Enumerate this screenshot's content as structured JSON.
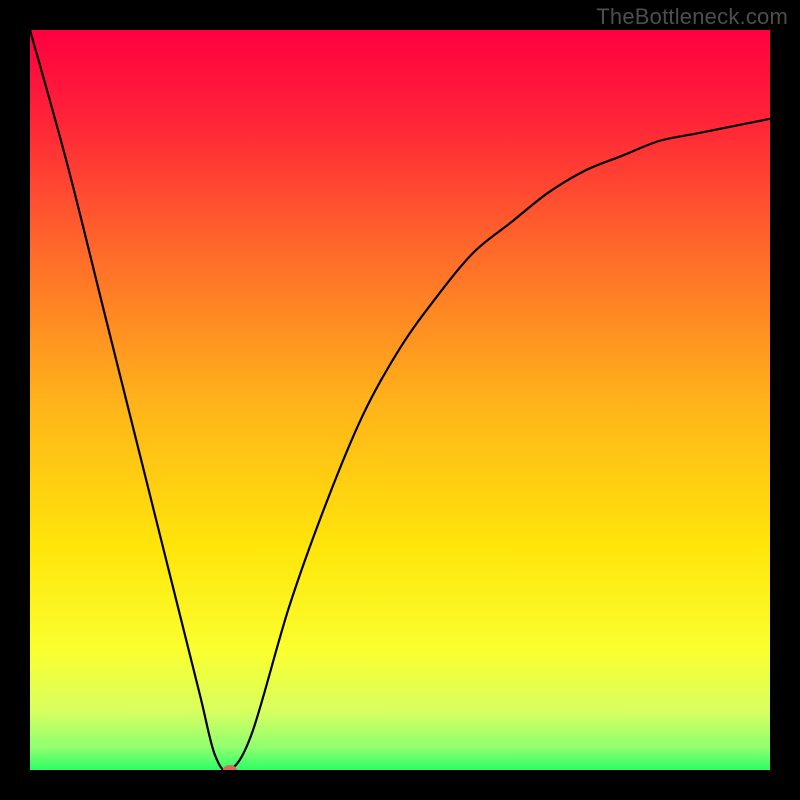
{
  "watermark": "TheBottleneck.com",
  "chart_data": {
    "type": "line",
    "title": "",
    "xlabel": "",
    "ylabel": "",
    "xlim": [
      0,
      100
    ],
    "ylim": [
      0,
      100
    ],
    "series": [
      {
        "name": "bottleneck-curve",
        "x": [
          0,
          5,
          10,
          15,
          20,
          23,
          25,
          27,
          30,
          35,
          40,
          45,
          50,
          55,
          60,
          65,
          70,
          75,
          80,
          85,
          90,
          95,
          100
        ],
        "values": [
          100,
          82,
          62,
          42,
          22,
          10,
          2,
          0,
          5,
          22,
          36,
          48,
          57,
          64,
          70,
          74,
          78,
          81,
          83,
          85,
          86,
          87,
          88
        ]
      }
    ],
    "marker": {
      "x": 27,
      "y": 0,
      "color": "#e06666"
    },
    "gradient_stops": [
      {
        "offset": 0.0,
        "color": "#ff0040"
      },
      {
        "offset": 0.12,
        "color": "#ff2338"
      },
      {
        "offset": 0.3,
        "color": "#ff6a2a"
      },
      {
        "offset": 0.5,
        "color": "#ffb21a"
      },
      {
        "offset": 0.7,
        "color": "#ffe60a"
      },
      {
        "offset": 0.84,
        "color": "#faff30"
      },
      {
        "offset": 0.92,
        "color": "#d8ff60"
      },
      {
        "offset": 0.97,
        "color": "#8fff70"
      },
      {
        "offset": 1.0,
        "color": "#2bff66"
      }
    ]
  }
}
